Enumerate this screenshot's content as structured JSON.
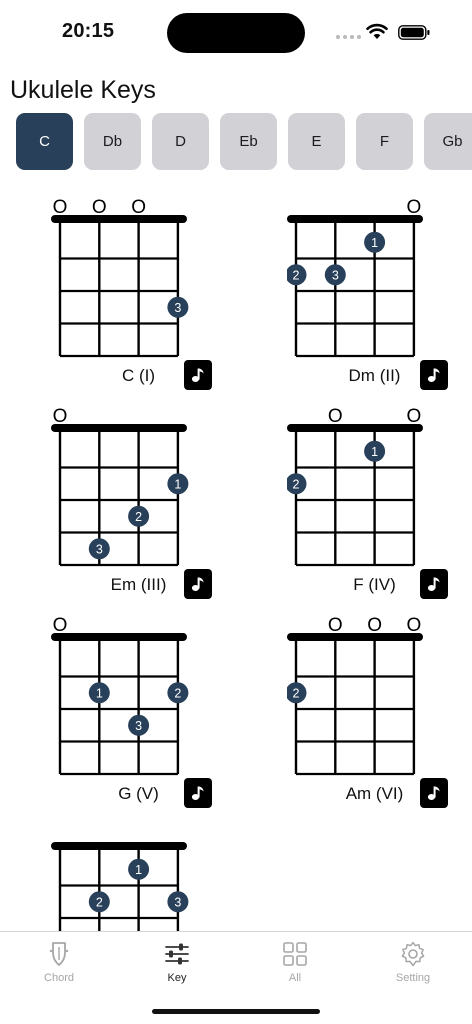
{
  "status": {
    "time": "20:15"
  },
  "app": {
    "title": "Ukulele Keys"
  },
  "keys": {
    "selected": "C",
    "items": [
      "C",
      "Db",
      "D",
      "Eb",
      "E",
      "F",
      "Gb"
    ]
  },
  "chords": [
    {
      "name": "C (I)",
      "open": [
        true,
        true,
        true,
        false
      ],
      "dots": [
        {
          "string": 4,
          "fret": 3,
          "finger": "3"
        }
      ]
    },
    {
      "name": "Dm (II)",
      "open": [
        false,
        false,
        false,
        true
      ],
      "dots": [
        {
          "string": 3,
          "fret": 1,
          "finger": "1"
        },
        {
          "string": 1,
          "fret": 2,
          "finger": "2"
        },
        {
          "string": 2,
          "fret": 2,
          "finger": "3"
        }
      ]
    },
    {
      "name": "Em (III)",
      "open": [
        true,
        false,
        false,
        false
      ],
      "dots": [
        {
          "string": 4,
          "fret": 2,
          "finger": "1"
        },
        {
          "string": 3,
          "fret": 3,
          "finger": "2"
        },
        {
          "string": 2,
          "fret": 4,
          "finger": "3"
        }
      ]
    },
    {
      "name": "F (IV)",
      "open": [
        false,
        true,
        false,
        true
      ],
      "dots": [
        {
          "string": 3,
          "fret": 1,
          "finger": "1"
        },
        {
          "string": 1,
          "fret": 2,
          "finger": "2"
        }
      ]
    },
    {
      "name": "G (V)",
      "open": [
        true,
        false,
        false,
        false
      ],
      "dots": [
        {
          "string": 2,
          "fret": 2,
          "finger": "1"
        },
        {
          "string": 4,
          "fret": 2,
          "finger": "2"
        },
        {
          "string": 3,
          "fret": 3,
          "finger": "3"
        }
      ]
    },
    {
      "name": "Am (VI)",
      "open": [
        false,
        true,
        true,
        true
      ],
      "dots": [
        {
          "string": 1,
          "fret": 2,
          "finger": "2"
        }
      ]
    },
    {
      "name": "",
      "open": [
        false,
        false,
        false,
        false
      ],
      "dots": [
        {
          "string": 3,
          "fret": 1,
          "finger": "1"
        },
        {
          "string": 2,
          "fret": 2,
          "finger": "2"
        },
        {
          "string": 4,
          "fret": 2,
          "finger": "3"
        }
      ]
    }
  ],
  "chord_symbols": {
    "open": "O"
  },
  "tabs": [
    {
      "label": "Chord",
      "icon": "guitar-pick-icon"
    },
    {
      "label": "Key",
      "icon": "sliders-icon"
    },
    {
      "label": "All",
      "icon": "grid-icon"
    },
    {
      "label": "Setting",
      "icon": "gear-icon"
    }
  ],
  "tab_active": "Key",
  "colors": {
    "accent": "#28405a",
    "chip": "#d1d1d6",
    "dot": "#28405a"
  }
}
